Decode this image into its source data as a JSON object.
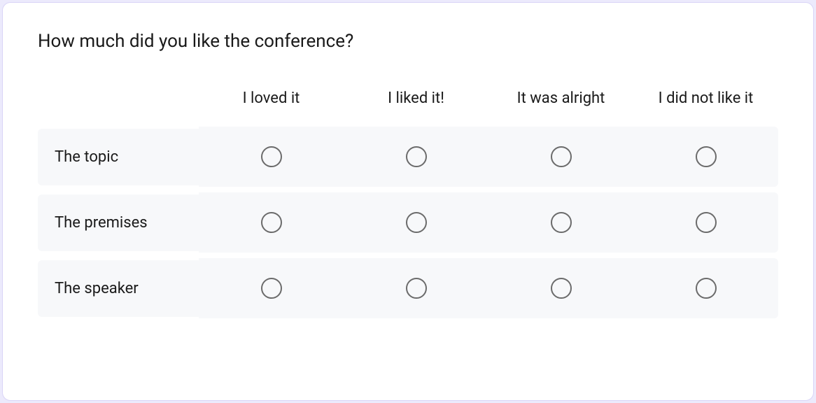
{
  "question": {
    "title": "How much did you like the conference?",
    "columns": [
      "I loved it",
      "I liked it!",
      "It was alright",
      "I did not like it"
    ],
    "rows": [
      "The topic",
      "The premises",
      "The speaker"
    ]
  }
}
